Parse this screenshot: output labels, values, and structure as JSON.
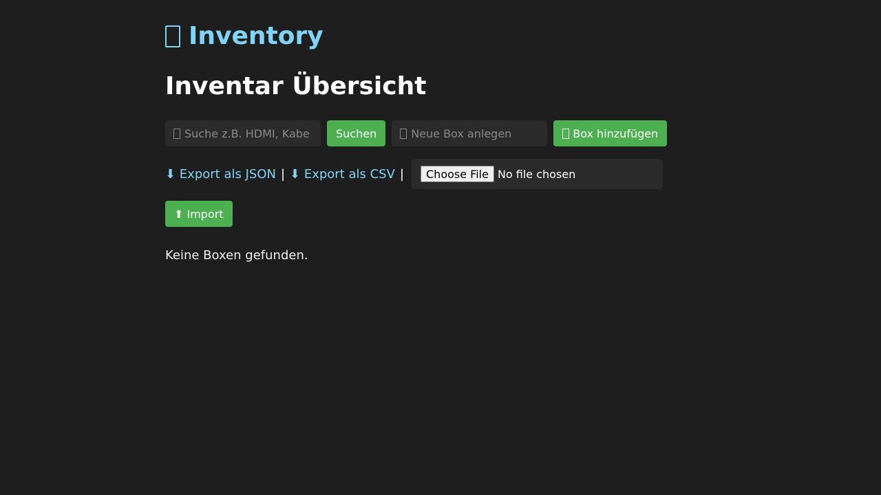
{
  "brand": {
    "icon": "package-icon",
    "title": "Inventory"
  },
  "page": {
    "title": "Inventar Übersicht",
    "empty_message": "Keine Boxen gefunden."
  },
  "search": {
    "placeholder": "Suche z.B. HDMI, Kabe",
    "button_label": "Suchen"
  },
  "new_box": {
    "placeholder": "Neue Box anlegen",
    "button_label": "Box hinzufügen"
  },
  "export": {
    "json_label": "⬇ Export als JSON",
    "separator": "|",
    "csv_label": "⬇ Export als CSV"
  },
  "import": {
    "choose_file_label": "Choose File",
    "file_status": "No file chosen",
    "button_label": "⬆ Import"
  },
  "colors": {
    "background": "#1e1e1e",
    "accent": "#7fd4f7",
    "button": "#4cb050",
    "field": "#2b2b2b"
  }
}
